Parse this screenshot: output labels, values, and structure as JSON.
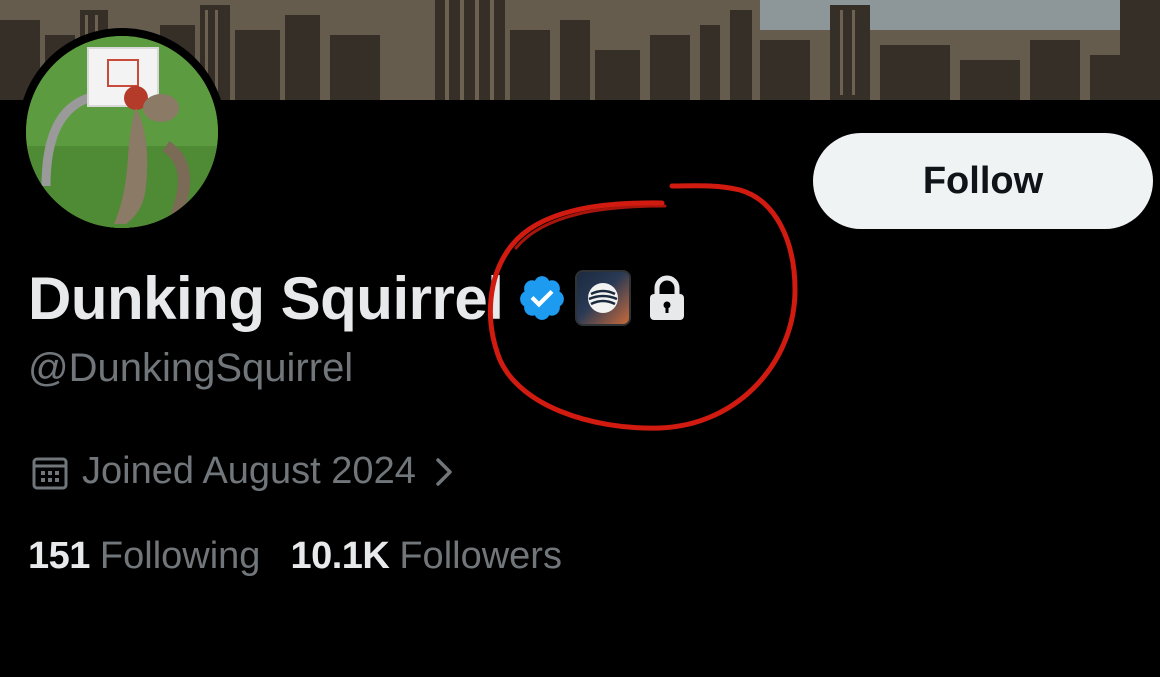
{
  "profile": {
    "display_name": "Dunking Squirrel",
    "handle": "@DunkingSquirrel",
    "joined": "Joined August 2024",
    "following_count": "151",
    "following_label": "Following",
    "followers_count": "10.1K",
    "followers_label": "Followers"
  },
  "actions": {
    "follow_label": "Follow"
  },
  "icons": {
    "verified": "verified-checkmark-icon",
    "affiliate": "affiliate-badge-icon",
    "protected": "lock-icon",
    "joined": "calendar-icon",
    "more": "chevron-right-icon"
  },
  "colors": {
    "background": "#000000",
    "primary_text": "#e7e9ea",
    "secondary_text": "#71767b",
    "verified_blue": "#1d9bf0",
    "follow_button_bg": "#eff3f4",
    "annotation_red": "#d11a10"
  }
}
